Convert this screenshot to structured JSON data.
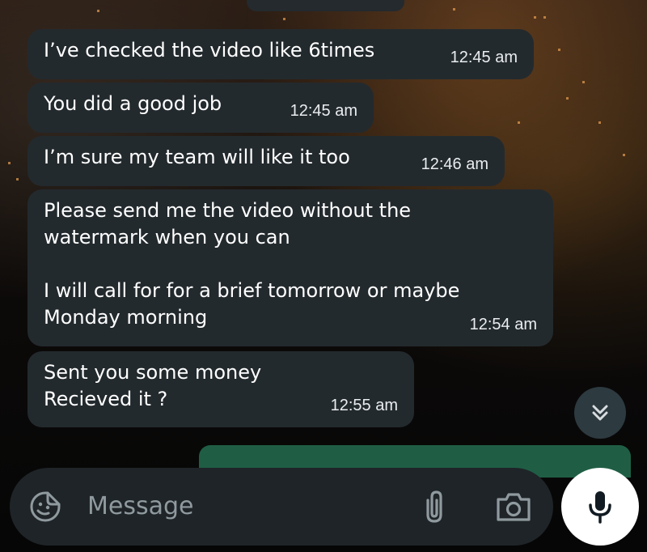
{
  "messages": [
    {
      "text": "I’ve checked the video like 6times",
      "time": "12:45 am"
    },
    {
      "text": "You did a good job",
      "time": "12:45 am"
    },
    {
      "text": "I’m sure my team will like it too",
      "time": "12:46 am"
    },
    {
      "text": "Please send me the video without the\nwatermark when you can\n\nI will call for for a brief tomorrow or maybe\nMonday morning",
      "time": "12:54 am"
    },
    {
      "text": "Sent you some money\nRecieved it ?",
      "time": "12:55 am"
    }
  ],
  "composer": {
    "placeholder": "Message"
  },
  "icons": {
    "emoji": "sticker-emoji-icon",
    "attach": "paperclip-icon",
    "camera": "camera-icon",
    "mic": "microphone-icon",
    "scroll": "double-chevron-down-icon"
  },
  "colors": {
    "incoming_bubble": "#232a2e",
    "outgoing_bubble": "#1f5e45",
    "input_bar": "#1f2428",
    "mic_button": "#ffffff"
  }
}
